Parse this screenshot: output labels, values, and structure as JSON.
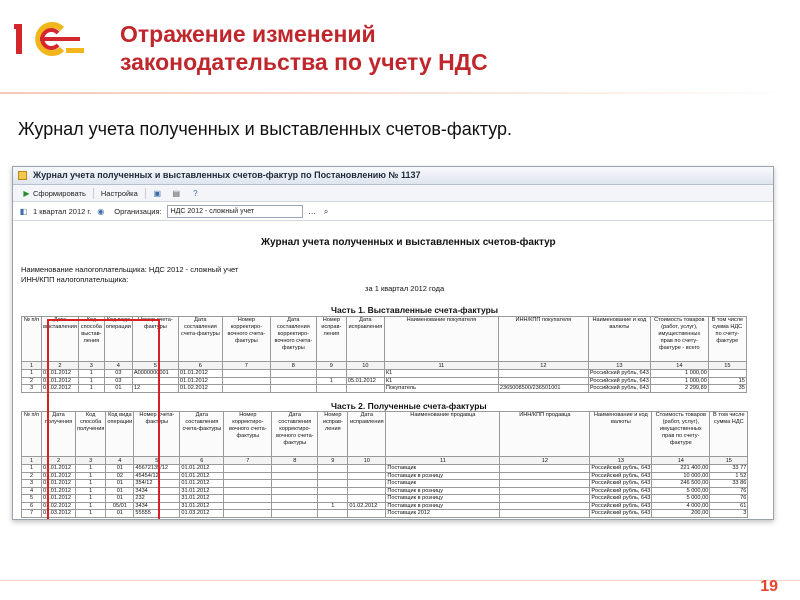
{
  "slide": {
    "title_line1": "Отражение изменений",
    "title_line2": "законодательства по учету НДС",
    "subtitle": "Журнал учета полученных и выставленных счетов-фактур.",
    "page_number": "19",
    "accent_color": "#c0272d",
    "logo_icon": "1c-logo-icon"
  },
  "window": {
    "title": "Журнал учета полученных и выставленных счетов-фактур по Постановлению № 1137",
    "toolbar": {
      "generate_label": "Сформировать",
      "settings_label": "Настройка"
    },
    "filters": {
      "period_value": "1 квартал 2012 г.",
      "org_label": "Организация:",
      "org_value": "НДС 2012 - сложный учет"
    }
  },
  "report": {
    "title": "Журнал учета полученных и выставленных счетов-фактур",
    "taxpayer": "Наименование налогоплательщика: НДС 2012 - сложный учет",
    "inn": "ИНН/КПП налогоплательщика:",
    "period": "за 1 квартал 2012 года",
    "part1": {
      "title": "Часть 1. Выставленные счета-фактуры",
      "headers": [
        "№ п/п",
        "Дата выставления",
        "Код способа выстав-ления",
        "Код вида операции",
        "Номер счета-фактуры",
        "Дата составления счета-фактуры",
        "Номер корректиро-вочного счета-фактуры",
        "Дата составления корректиро-вочного счета-фактуры",
        "Номер исправ-ления",
        "Дата исправления",
        "Наименование покупателя",
        "ИНН/КПП покупателя",
        "Наименование и код валюты",
        "Стоимость товаров (работ, услуг), имущественных прав по счету-фактуре - всего",
        "В том числе сумма НДС по счету-фактуре"
      ],
      "numbers": [
        "1",
        "2",
        "3",
        "4",
        "5",
        "6",
        "7",
        "8",
        "9",
        "10",
        "11",
        "12",
        "13",
        "14",
        "15"
      ],
      "rows": [
        [
          "1",
          "01.01.2012",
          "1",
          "03",
          "А0000000001",
          "01.01.2012",
          "",
          "",
          "",
          "",
          "К1",
          "",
          "Российский рубль, 643",
          "1 000,00",
          ""
        ],
        [
          "2",
          "01.01.2012",
          "1",
          "03",
          "",
          "01.01.2012",
          "",
          "",
          "1",
          "05.01.2012",
          "К1",
          "",
          "Российский рубль, 643",
          "1 000,00",
          "15"
        ],
        [
          "3",
          "01.02.2012",
          "1",
          "01",
          "12",
          "01.02.2012",
          "",
          "",
          "",
          "",
          "Покупатель",
          "2365008500/236501001",
          "Российский рубль, 643",
          "2 299,89",
          "35"
        ]
      ]
    },
    "part2": {
      "title": "Часть 2. Полученные счета-фактуры",
      "headers": [
        "№ п/п",
        "Дата получения",
        "Код способа получения",
        "Код вида операции",
        "Номер счета-фактуры",
        "Дата составления счета-фактуры",
        "Номер корректиро-вочного счета-фактуры",
        "Дата составления корректиро-вочного счета-фактуры",
        "Номер исправ-ления",
        "Дата исправления",
        "Наименование продавца",
        "ИНН/КПП продавца",
        "Наименование и код валюты",
        "Стоимость товаров (работ, услуг), имущественных прав по счету-фактуре",
        "В том числе сумма НДС"
      ],
      "numbers": [
        "1",
        "2",
        "3",
        "4",
        "5",
        "6",
        "7",
        "8",
        "9",
        "10",
        "11",
        "12",
        "13",
        "14",
        "15"
      ],
      "rows": [
        [
          "1",
          "01.01.2012",
          "1",
          "01",
          "45672135/12",
          "01.01.2012",
          "",
          "",
          "",
          "",
          "Поставщик",
          "",
          "Российский рубль, 643",
          "221 400,00",
          "33 77"
        ],
        [
          "2",
          "01.01.2012",
          "1",
          "02",
          "45454/12",
          "01.01.2012",
          "",
          "",
          "",
          "",
          "Поставщик в розницу",
          "",
          "Российский рубль, 643",
          "10 000,00",
          "1 52"
        ],
        [
          "3",
          "01.01.2012",
          "1",
          "01",
          "354/12",
          "01.01.2012",
          "",
          "",
          "",
          "",
          "Поставщик",
          "",
          "Российский рубль, 643",
          "246 500,00",
          "33 86"
        ],
        [
          "4",
          "01.01.2012",
          "1",
          "01",
          "3434",
          "31.01.2012",
          "",
          "",
          "",
          "",
          "Поставщик в розницу",
          "",
          "Российский рубль, 643",
          "5 000,00",
          "76"
        ],
        [
          "5",
          "01.01.2012",
          "1",
          "01",
          "232",
          "31.01.2012",
          "",
          "",
          "",
          "",
          "Поставщик в розницу",
          "",
          "Российский рубль, 643",
          "5 000,00",
          "76"
        ],
        [
          "6",
          "01.02.2012",
          "1",
          "05/01",
          "3434",
          "31.01.2012",
          "",
          "",
          "1",
          "01.02.2012",
          "Поставщик в розницу",
          "",
          "Российский рубль, 643",
          "4 000,00",
          "61"
        ],
        [
          "7",
          "01.03.2012",
          "1",
          "01",
          "55555",
          "01.03.2012",
          "",
          "",
          "",
          "",
          "Поставщик 2012",
          "",
          "Российский рубль, 643",
          "200,00",
          "3"
        ]
      ]
    }
  }
}
